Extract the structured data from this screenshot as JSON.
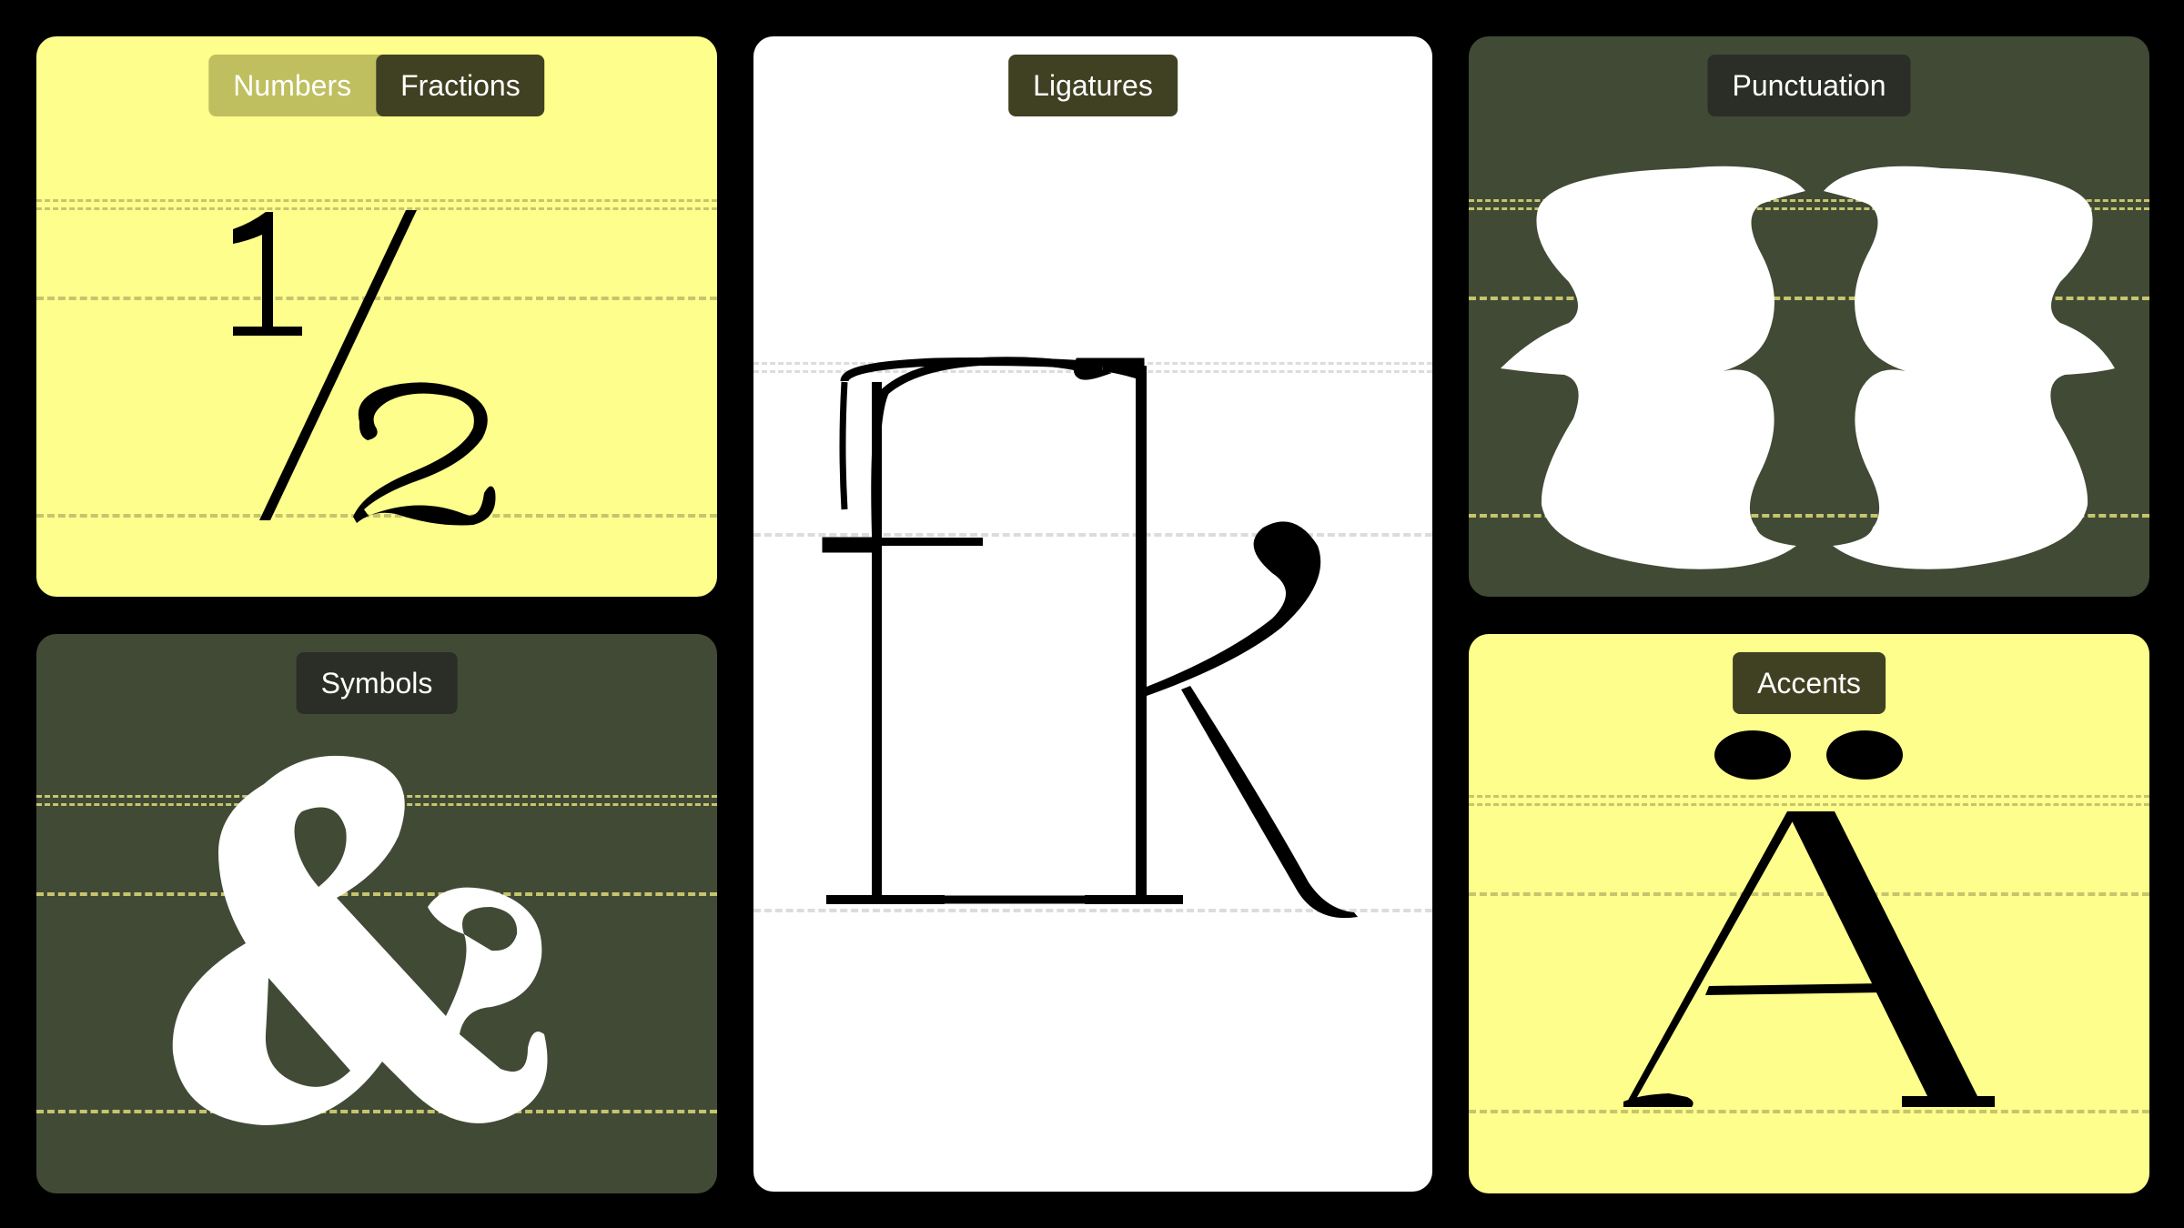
{
  "cards": {
    "fractions": {
      "tabs": [
        "Numbers",
        "Fractions"
      ],
      "active_tab": "Fractions",
      "glyph_label": "1/2"
    },
    "symbols": {
      "label": "Symbols",
      "glyph_label": "&"
    },
    "ligatures": {
      "label": "Ligatures",
      "glyph_label": "fk"
    },
    "punctuation": {
      "label": "Punctuation",
      "glyph_label": "{}"
    },
    "accents": {
      "label": "Accents",
      "glyph_label": "Ä"
    }
  },
  "colors": {
    "background": "#000000",
    "yellow_card": "#FDFE8C",
    "olive_card": "#414A35",
    "white_card": "#FFFFFF",
    "pill_dark": "#2B2E26",
    "pill_olive": "#404122",
    "segment_inactive": "#BFBF60",
    "guide_yellow": "#C6C56E",
    "guide_gray": "#DCDCDC"
  },
  "icons": [
    "fraction-one-half-glyph",
    "ampersand-glyph",
    "fk-ligature-glyph",
    "curly-braces-glyph",
    "a-diaeresis-glyph"
  ]
}
